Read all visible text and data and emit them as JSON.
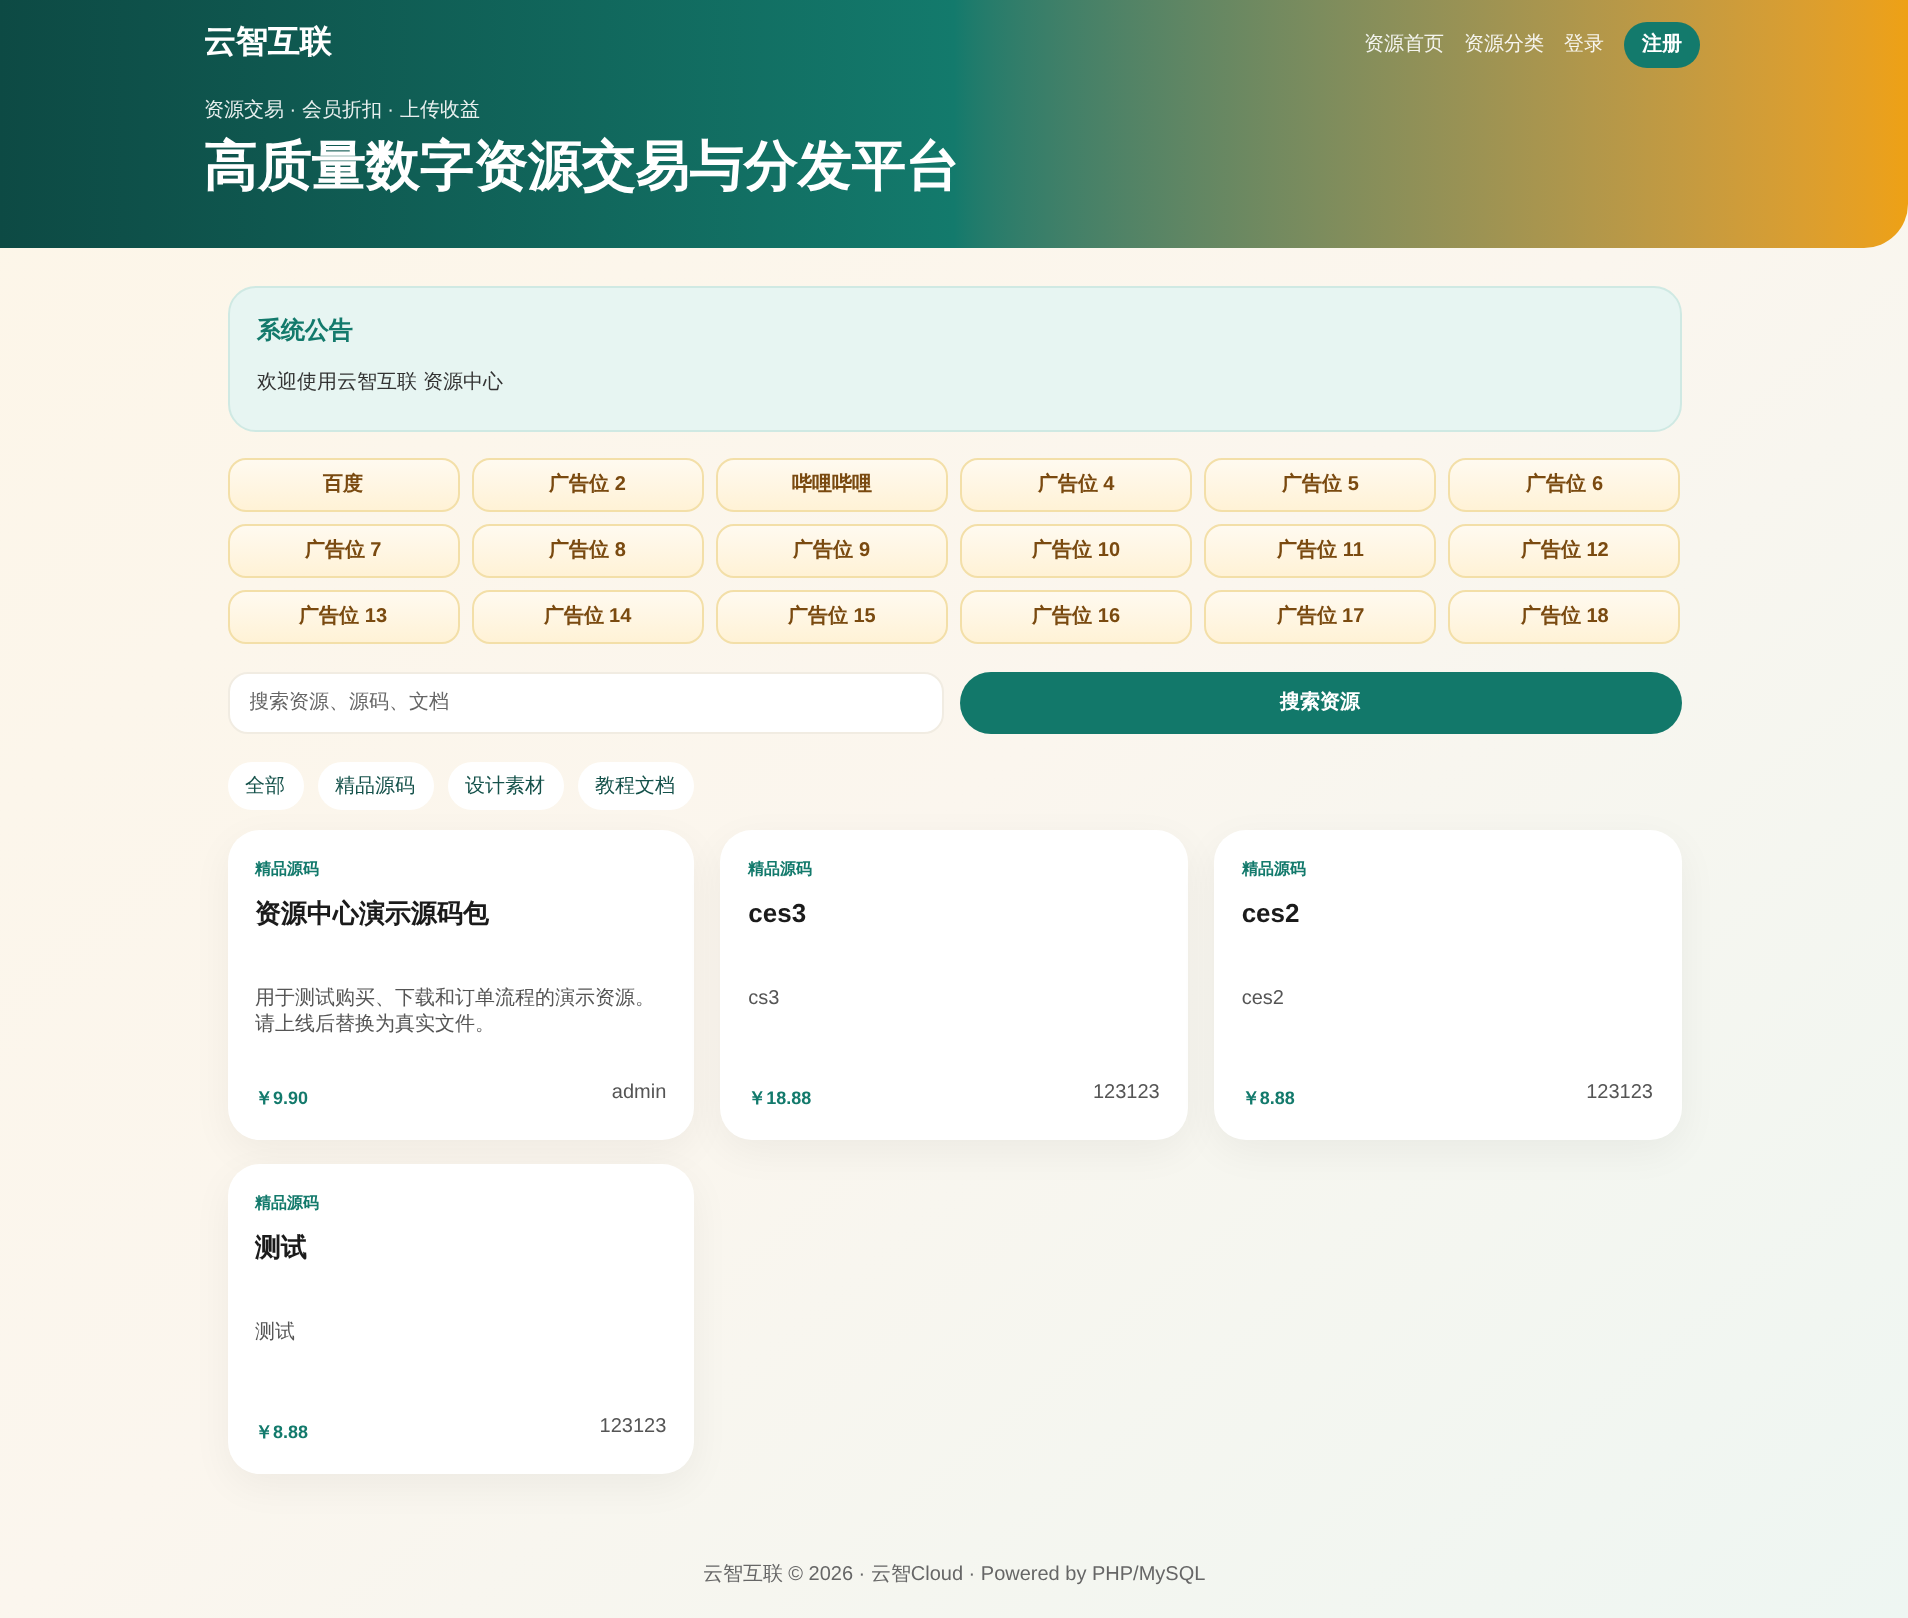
{
  "header": {
    "brand": "云智互联",
    "nav": [
      "资源首页",
      "资源分类",
      "登录"
    ],
    "register": "注册",
    "tagline": "资源交易 · 会员折扣 · 上传收益",
    "headline": "高质量数字资源交易与分发平台"
  },
  "notice": {
    "title": "系统公告",
    "text": "欢迎使用云智互联 资源中心"
  },
  "ads": [
    "百度",
    "广告位 2",
    "哔哩哔哩",
    "广告位 4",
    "广告位 5",
    "广告位 6",
    "广告位 7",
    "广告位 8",
    "广告位 9",
    "广告位 10",
    "广告位 11",
    "广告位 12",
    "广告位 13",
    "广告位 14",
    "广告位 15",
    "广告位 16",
    "广告位 17",
    "广告位 18"
  ],
  "search": {
    "placeholder": "搜索资源、源码、文档",
    "button": "搜索资源"
  },
  "filters": [
    "全部",
    "精品源码",
    "设计素材",
    "教程文档"
  ],
  "resources": [
    {
      "category": "精品源码",
      "title": "资源中心演示源码包",
      "description": "用于测试购买、下载和订单流程的演示资源。请上线后替换为真实文件。",
      "price": "￥9.90",
      "author": "admin"
    },
    {
      "category": "精品源码",
      "title": "ces3",
      "description": "cs3",
      "price": "￥18.88",
      "author": "123123"
    },
    {
      "category": "精品源码",
      "title": "ces2",
      "description": "ces2",
      "price": "￥8.88",
      "author": "123123"
    },
    {
      "category": "精品源码",
      "title": "测试",
      "description": "测试",
      "price": "￥8.88",
      "author": "123123"
    }
  ],
  "footer": "云智互联 © 2026 · 云智Cloud · Powered by PHP/MySQL"
}
